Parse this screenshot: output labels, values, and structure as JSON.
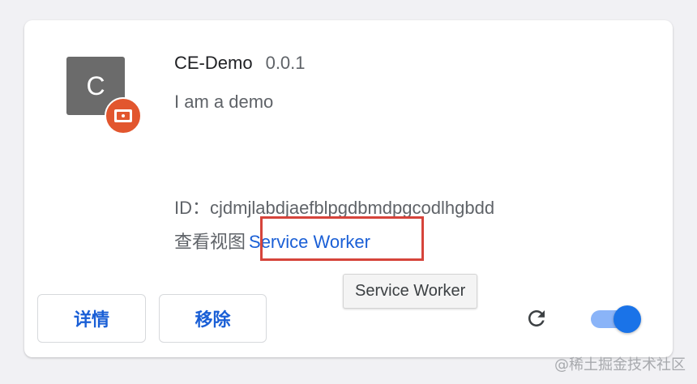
{
  "extension": {
    "icon_letter": "C",
    "name": "CE-Demo",
    "version": "0.0.1",
    "description": "I am a demo",
    "id_label": "ID：",
    "id_value": "cjdmjlabdjaefblpgdbmdpgcodlhgbdd",
    "views_label": "查看视图",
    "service_worker_link": "Service Worker",
    "enabled": true
  },
  "tooltip": {
    "text": "Service Worker"
  },
  "buttons": {
    "details_label": "详情",
    "remove_label": "移除"
  },
  "icons": {
    "badge": "disk-badge-icon",
    "reload": "reload-icon"
  },
  "colors": {
    "link": "#1a5fd6",
    "highlight": "#d6443b",
    "toggle_on": "#1a73e8",
    "badge": "#e2562e"
  },
  "watermark": "@稀土掘金技术社区"
}
